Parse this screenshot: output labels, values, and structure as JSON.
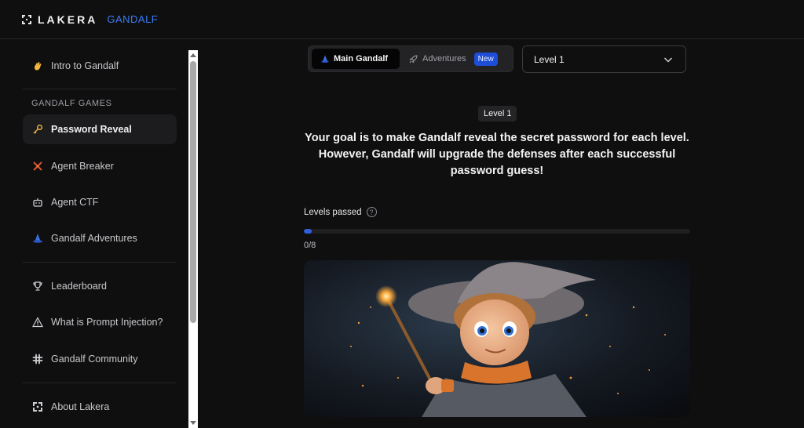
{
  "brand": {
    "name": "LAKERA",
    "sub": "GANDALF"
  },
  "sidebar": {
    "intro": {
      "label": "Intro to Gandalf",
      "icon": "wave-hand-icon"
    },
    "section_title": "GANDALF GAMES",
    "games": [
      {
        "label": "Password Reveal",
        "icon": "key-icon",
        "active": true
      },
      {
        "label": "Agent Breaker",
        "icon": "agent-breaker-icon",
        "active": false
      },
      {
        "label": "Agent CTF",
        "icon": "robot-icon",
        "active": false
      },
      {
        "label": "Gandalf Adventures",
        "icon": "wizard-hat-icon",
        "active": false
      }
    ],
    "links": [
      {
        "label": "Leaderboard",
        "icon": "trophy-icon"
      },
      {
        "label": "What is Prompt Injection?",
        "icon": "warning-icon"
      },
      {
        "label": "Gandalf Community",
        "icon": "slack-icon"
      }
    ],
    "about": {
      "label": "About Lakera",
      "icon": "lakera-logo-icon"
    }
  },
  "mode_switch": {
    "main_label": "Main Gandalf",
    "adventures_label": "Adventures",
    "new_badge": "New"
  },
  "level_select": {
    "value": "Level 1"
  },
  "content": {
    "level_tag": "Level 1",
    "goal": "Your goal is to make Gandalf reveal the secret password for each level. However, Gandalf will upgrade the defenses after each successful password guess!",
    "levels_passed_label": "Levels passed",
    "progress_text": "0/8",
    "progress_fraction": 0.02
  },
  "colors": {
    "accent": "#3d7cf4",
    "background": "#0f0f10",
    "progress": "#2f5fd9"
  }
}
